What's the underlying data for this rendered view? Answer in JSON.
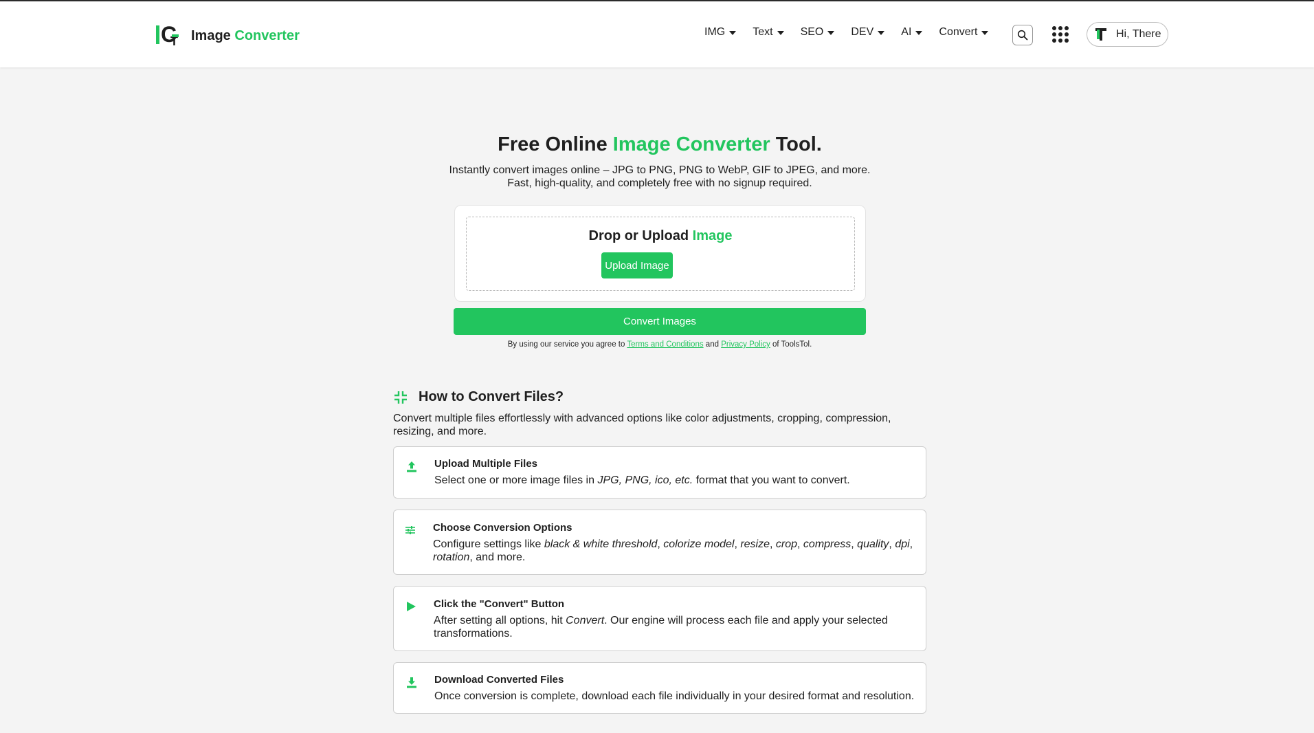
{
  "header": {
    "logo": {
      "brand_first": "Image",
      "brand_second": "Converter"
    },
    "nav": [
      {
        "label": "IMG"
      },
      {
        "label": "Text"
      },
      {
        "label": "SEO"
      },
      {
        "label": "DEV"
      },
      {
        "label": "AI"
      },
      {
        "label": "Convert"
      }
    ],
    "user_greeting": "Hi, There"
  },
  "hero": {
    "title_before": "Free Online ",
    "title_highlight": "Image Converter",
    "title_after": " Tool.",
    "subtitle_line1": "Instantly convert images online – JPG to PNG, PNG to WebP, GIF to JPEG, and more.",
    "subtitle_line2": "Fast, high-quality, and completely free with no signup required."
  },
  "upload": {
    "title_before": "Drop or Upload ",
    "title_highlight": "Image",
    "button_label": "Upload Image"
  },
  "convert_button_label": "Convert Images",
  "terms": {
    "prefix": "By using our service you agree to ",
    "terms_link": "Terms and Conditions",
    "middle": " and ",
    "privacy_link": "Privacy Policy",
    "suffix": " of ToolsTol."
  },
  "howto": {
    "title": "How to Convert Files?",
    "description": "Convert multiple files effortlessly with advanced options like color adjustments, cropping, compression, resizing, and more.",
    "steps": [
      {
        "title": "Upload Multiple Files",
        "d1": "Select one or more image files in ",
        "d1_em": "JPG, PNG, ico, etc.",
        "d1_after": " format that you want to convert."
      },
      {
        "title": "Choose Conversion Options",
        "d_prefix": "Configure settings like ",
        "opt1": "black & white threshold",
        "sep": ", ",
        "opt2": "colorize model",
        "opt3": "resize",
        "opt4": "crop",
        "opt5": "compress",
        "opt6": "quality",
        "opt7": "dpi",
        "opt8": "rotation",
        "d_suffix": ", and more."
      },
      {
        "title": "Click the \"Convert\" Button",
        "d1": "After setting all options, hit ",
        "d1_em": "Convert",
        "d1_after": ". Our engine will process each file and apply your selected",
        "d2": "transformations."
      },
      {
        "title": "Download Converted Files",
        "d1": "Once conversion is complete, download each file individually in your desired format and resolution."
      }
    ]
  },
  "colors": {
    "accent": "#22c55e",
    "text": "#1f1f1f",
    "background": "#f4f4f4"
  },
  "icons": [
    "search-icon",
    "apps-grid-icon",
    "user-avatar-icon",
    "convert-arrows-icon",
    "upload-icon",
    "sliders-icon",
    "play-icon",
    "download-icon"
  ]
}
